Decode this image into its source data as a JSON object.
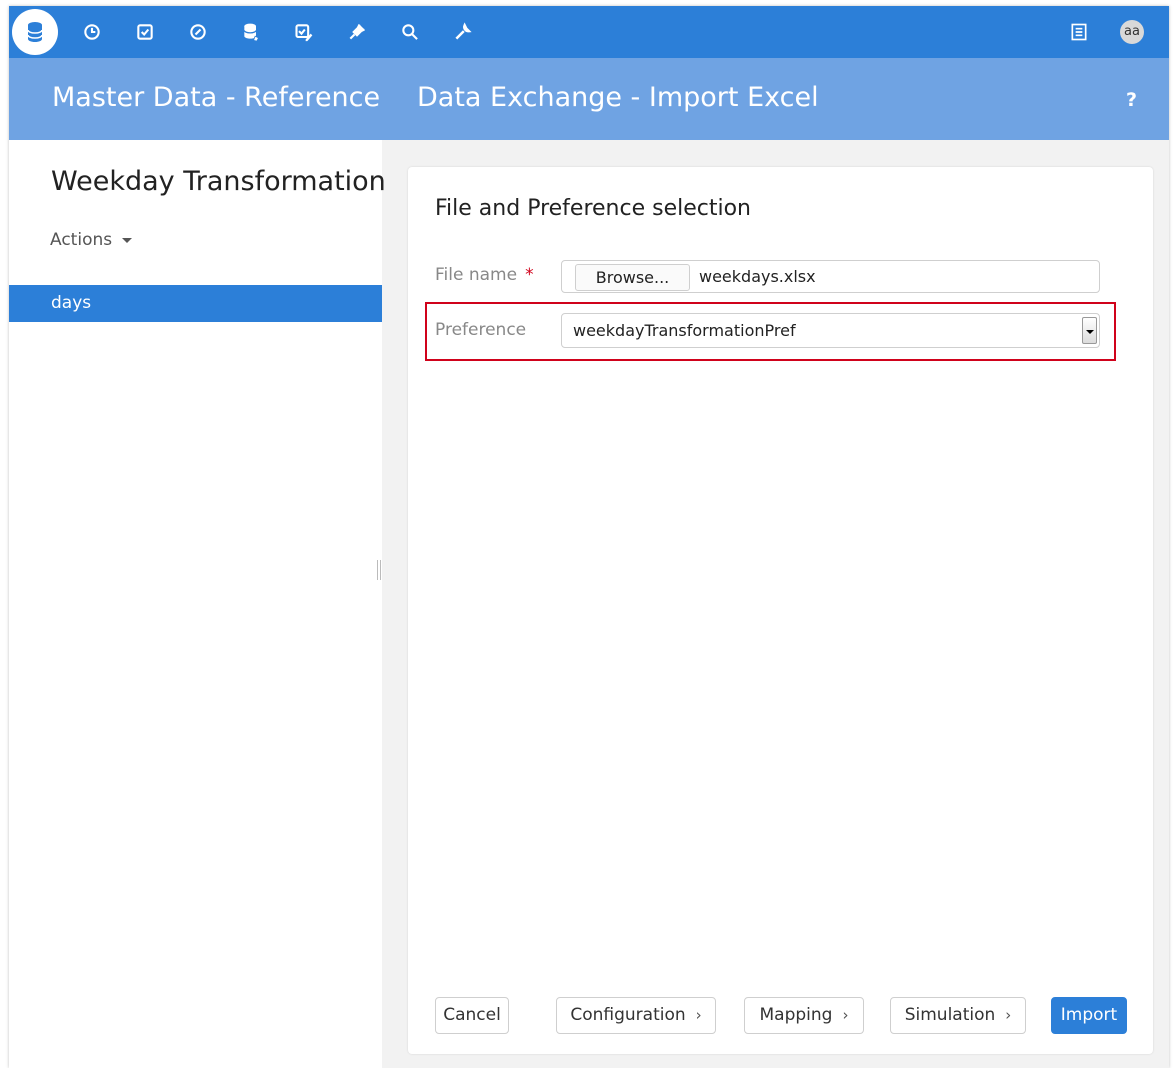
{
  "toolbar": {
    "icons": [
      "database-icon",
      "clock-icon",
      "checkbox-icon",
      "gauge-icon",
      "database-edit-icon",
      "checkbox-edit-icon",
      "plug-icon",
      "search-icon",
      "wrench-icon"
    ],
    "right_icons": [
      "list-icon"
    ],
    "avatar": "aa",
    "color": "#2c7fd8"
  },
  "header": {
    "left_title": "Master Data - Reference",
    "right_title": "Data Exchange - Import Excel",
    "help": "?"
  },
  "sidebar": {
    "title": "Weekday Transformation",
    "actions_label": "Actions",
    "items": [
      {
        "label": "days",
        "selected": true
      }
    ]
  },
  "form": {
    "title": "File and Preference selection",
    "file_label": "File name",
    "required_mark": "*",
    "browse_label": "Browse...",
    "file_value": "weekdays.xlsx",
    "preference_label": "Preference",
    "preference_value": "weekdayTransformationPref"
  },
  "footer": {
    "cancel": "Cancel",
    "configuration": "Configuration",
    "mapping": "Mapping",
    "simulation": "Simulation",
    "import": "Import",
    "chevron": "›"
  },
  "colors": {
    "accent": "#2c7fd8",
    "header": "#6fa3e3",
    "highlight": "#d0021b"
  }
}
